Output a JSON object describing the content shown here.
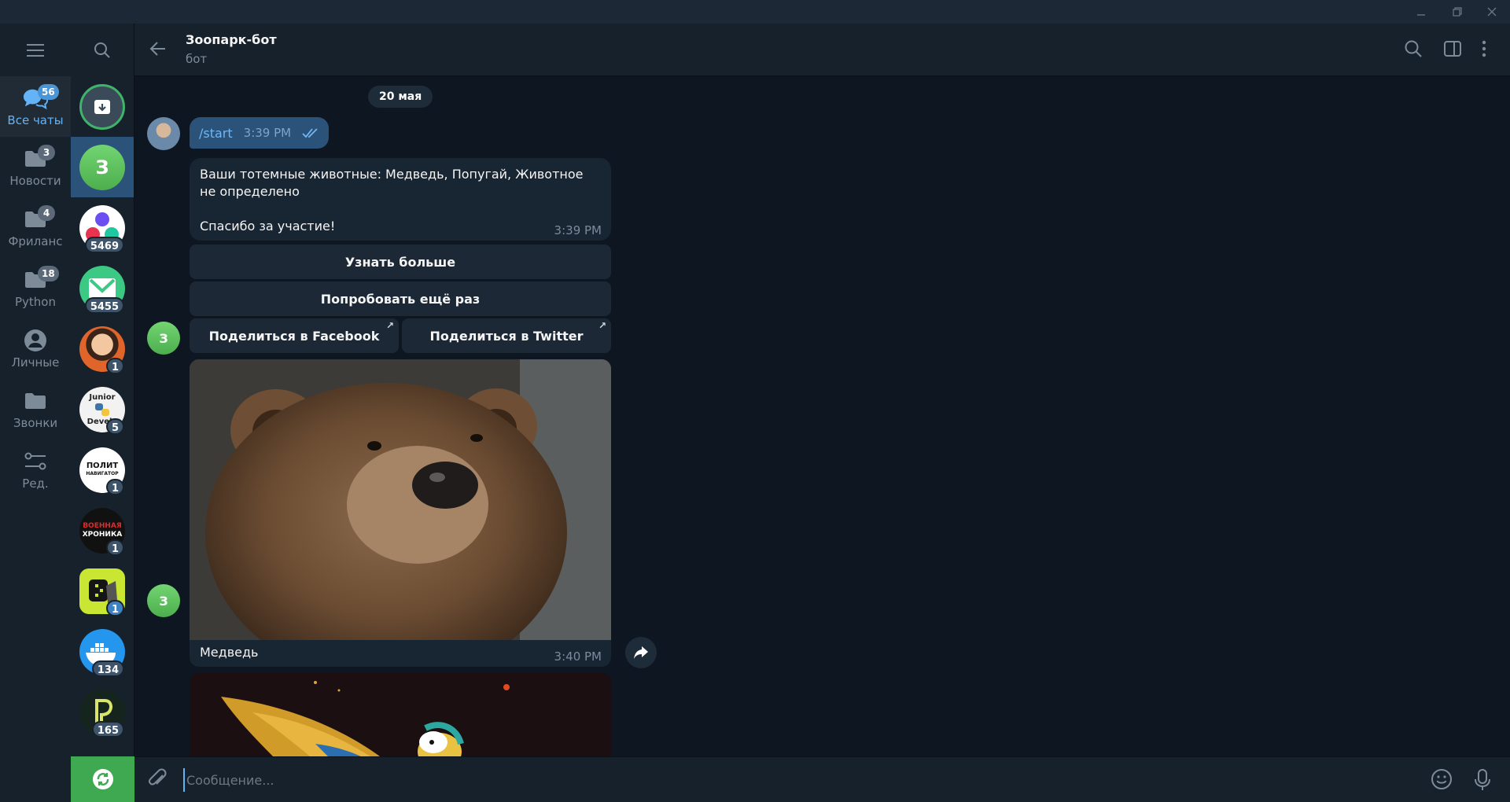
{
  "window": {
    "controls": [
      "minimize",
      "restore",
      "close"
    ]
  },
  "folders": {
    "items": [
      {
        "label": "Все чаты",
        "badge": "56",
        "icon": "chats-icon",
        "active": true
      },
      {
        "label": "Новости",
        "badge": "3",
        "icon": "folder-icon"
      },
      {
        "label": "Фриланс",
        "badge": "4",
        "icon": "folder-icon"
      },
      {
        "label": "Python",
        "badge": "18",
        "icon": "folder-icon"
      },
      {
        "label": "Личные",
        "badge": "",
        "icon": "user-icon"
      },
      {
        "label": "Звонки",
        "badge": "",
        "icon": "folder-icon"
      },
      {
        "label": "Ред.",
        "badge": "",
        "icon": "sliders-icon"
      }
    ]
  },
  "chats": {
    "items": [
      {
        "name": "archive",
        "letter": "",
        "badge": "",
        "color": "#3b4a59"
      },
      {
        "name": "zoopark-bot",
        "letter": "З",
        "badge": "",
        "color": "#5cb85c"
      },
      {
        "name": "chat-3",
        "letter": "",
        "badge": "5469",
        "color": "#ffffff"
      },
      {
        "name": "chat-4",
        "letter": "",
        "badge": "5455",
        "color": "#4ec78a"
      },
      {
        "name": "chat-5",
        "letter": "",
        "badge": "1",
        "color": "#c0562a"
      },
      {
        "name": "chat-6",
        "letter": "",
        "badge": "5",
        "color": "#f2f2f2"
      },
      {
        "name": "chat-7",
        "letter": "",
        "badge": "1",
        "color": "#ffffff"
      },
      {
        "name": "chat-8",
        "letter": "",
        "badge": "1",
        "color": "#111111"
      },
      {
        "name": "chat-9",
        "letter": "",
        "badge": "1",
        "color": "#c8e632"
      },
      {
        "name": "chat-10",
        "letter": "",
        "badge": "134",
        "color": "#2496ed"
      },
      {
        "name": "chat-11",
        "letter": "",
        "badge": "165",
        "color": "#15241c"
      }
    ],
    "avatar_texts": {
      "junior": "Junior",
      "develo": "Develo",
      "polit1": "ПОЛИТ",
      "polit2": "НАВИГАТОР",
      "voen1": "ВОЕННАЯ",
      "voen2": "ХРОНИКА"
    }
  },
  "header": {
    "title": "Зоопарк-бот",
    "subtitle": "бот"
  },
  "messages": {
    "date": "20 мая",
    "outgoing": {
      "text": "/start",
      "time": "3:39 PM"
    },
    "bot_avatar_letter": "З",
    "incoming": {
      "line1": "Ваши тотемные животные: Медведь, Попугай, Животное не определено",
      "line2": "Спасибо за участие!",
      "time": "3:39 PM"
    },
    "keyboard": {
      "learn_more": "Узнать больше",
      "try_again": "Попробовать ещё раз",
      "share_facebook": "Поделиться в Facebook",
      "share_twitter": "Поделиться в Twitter"
    },
    "photo": {
      "caption": "Медведь",
      "time": "3:40 PM"
    }
  },
  "composer": {
    "placeholder": "Сообщение..."
  }
}
